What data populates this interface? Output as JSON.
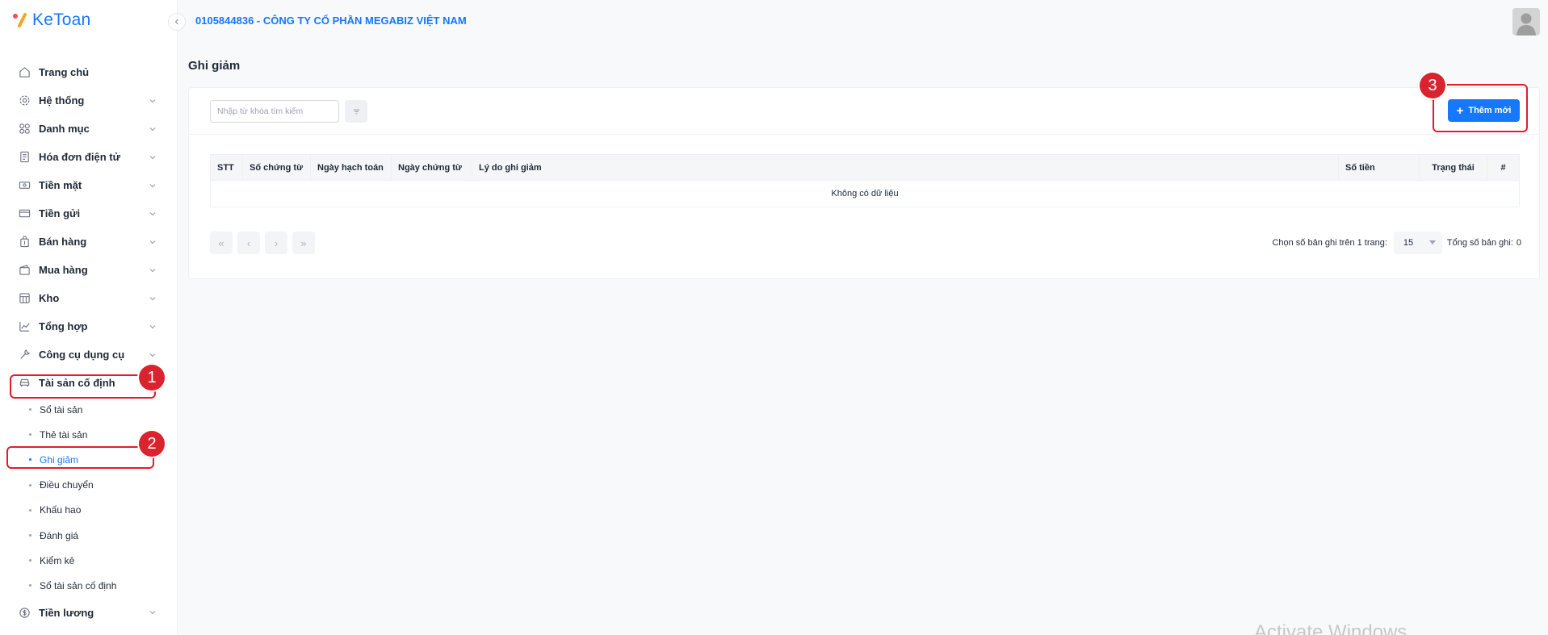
{
  "app": {
    "logo_text": "KeToan",
    "company": "0105844836 - CÔNG TY CỔ PHẦN MEGABIZ VIỆT NAM"
  },
  "sidebar": {
    "items": [
      {
        "label": "Trang chủ",
        "icon": "home-icon"
      },
      {
        "label": "Hệ thống",
        "icon": "gear-icon"
      },
      {
        "label": "Danh mục",
        "icon": "grid-icon"
      },
      {
        "label": "Hóa đơn điện tử",
        "icon": "invoice-icon"
      },
      {
        "label": "Tiền mặt",
        "icon": "cash-icon"
      },
      {
        "label": "Tiền gửi",
        "icon": "card-icon"
      },
      {
        "label": "Bán hàng",
        "icon": "bag-icon"
      },
      {
        "label": "Mua hàng",
        "icon": "wallet-icon"
      },
      {
        "label": "Kho",
        "icon": "warehouse-icon"
      },
      {
        "label": "Tổng hợp",
        "icon": "chart-icon"
      },
      {
        "label": "Công cụ dụng cụ",
        "icon": "tools-icon"
      },
      {
        "label": "Tài sản cố định",
        "icon": "car-icon"
      }
    ],
    "subitems": [
      {
        "label": "Sổ tài sản"
      },
      {
        "label": "Thẻ tài sản"
      },
      {
        "label": "Ghi giảm"
      },
      {
        "label": "Điều chuyển"
      },
      {
        "label": "Khấu hao"
      },
      {
        "label": "Đánh giá"
      },
      {
        "label": "Kiểm kê"
      },
      {
        "label": "Sổ tài sản cố định"
      }
    ],
    "last_item": {
      "label": "Tiền lương",
      "icon": "salary-icon"
    }
  },
  "main": {
    "page_title": "Ghi giảm",
    "search_placeholder": "Nhập từ khóa tìm kiếm",
    "add_label": "Thêm mới",
    "table": {
      "columns": [
        "STT",
        "Số chứng từ",
        "Ngày hạch toán",
        "Ngày chứng từ",
        "Lý do ghi giảm",
        "Số tiền",
        "Trạng thái",
        "#"
      ],
      "empty_text": "Không có dữ liệu"
    },
    "pagination": {
      "page_size_label": "Chọn số bản ghi trên 1 trang:",
      "page_size": "15",
      "total_label": "Tổng số bản ghi:",
      "total": "0"
    }
  },
  "annotations": [
    "1",
    "2",
    "3"
  ],
  "watermark": "Activate Windows",
  "colors": {
    "accent": "#1677ff",
    "annotation": "#e11d2a"
  }
}
